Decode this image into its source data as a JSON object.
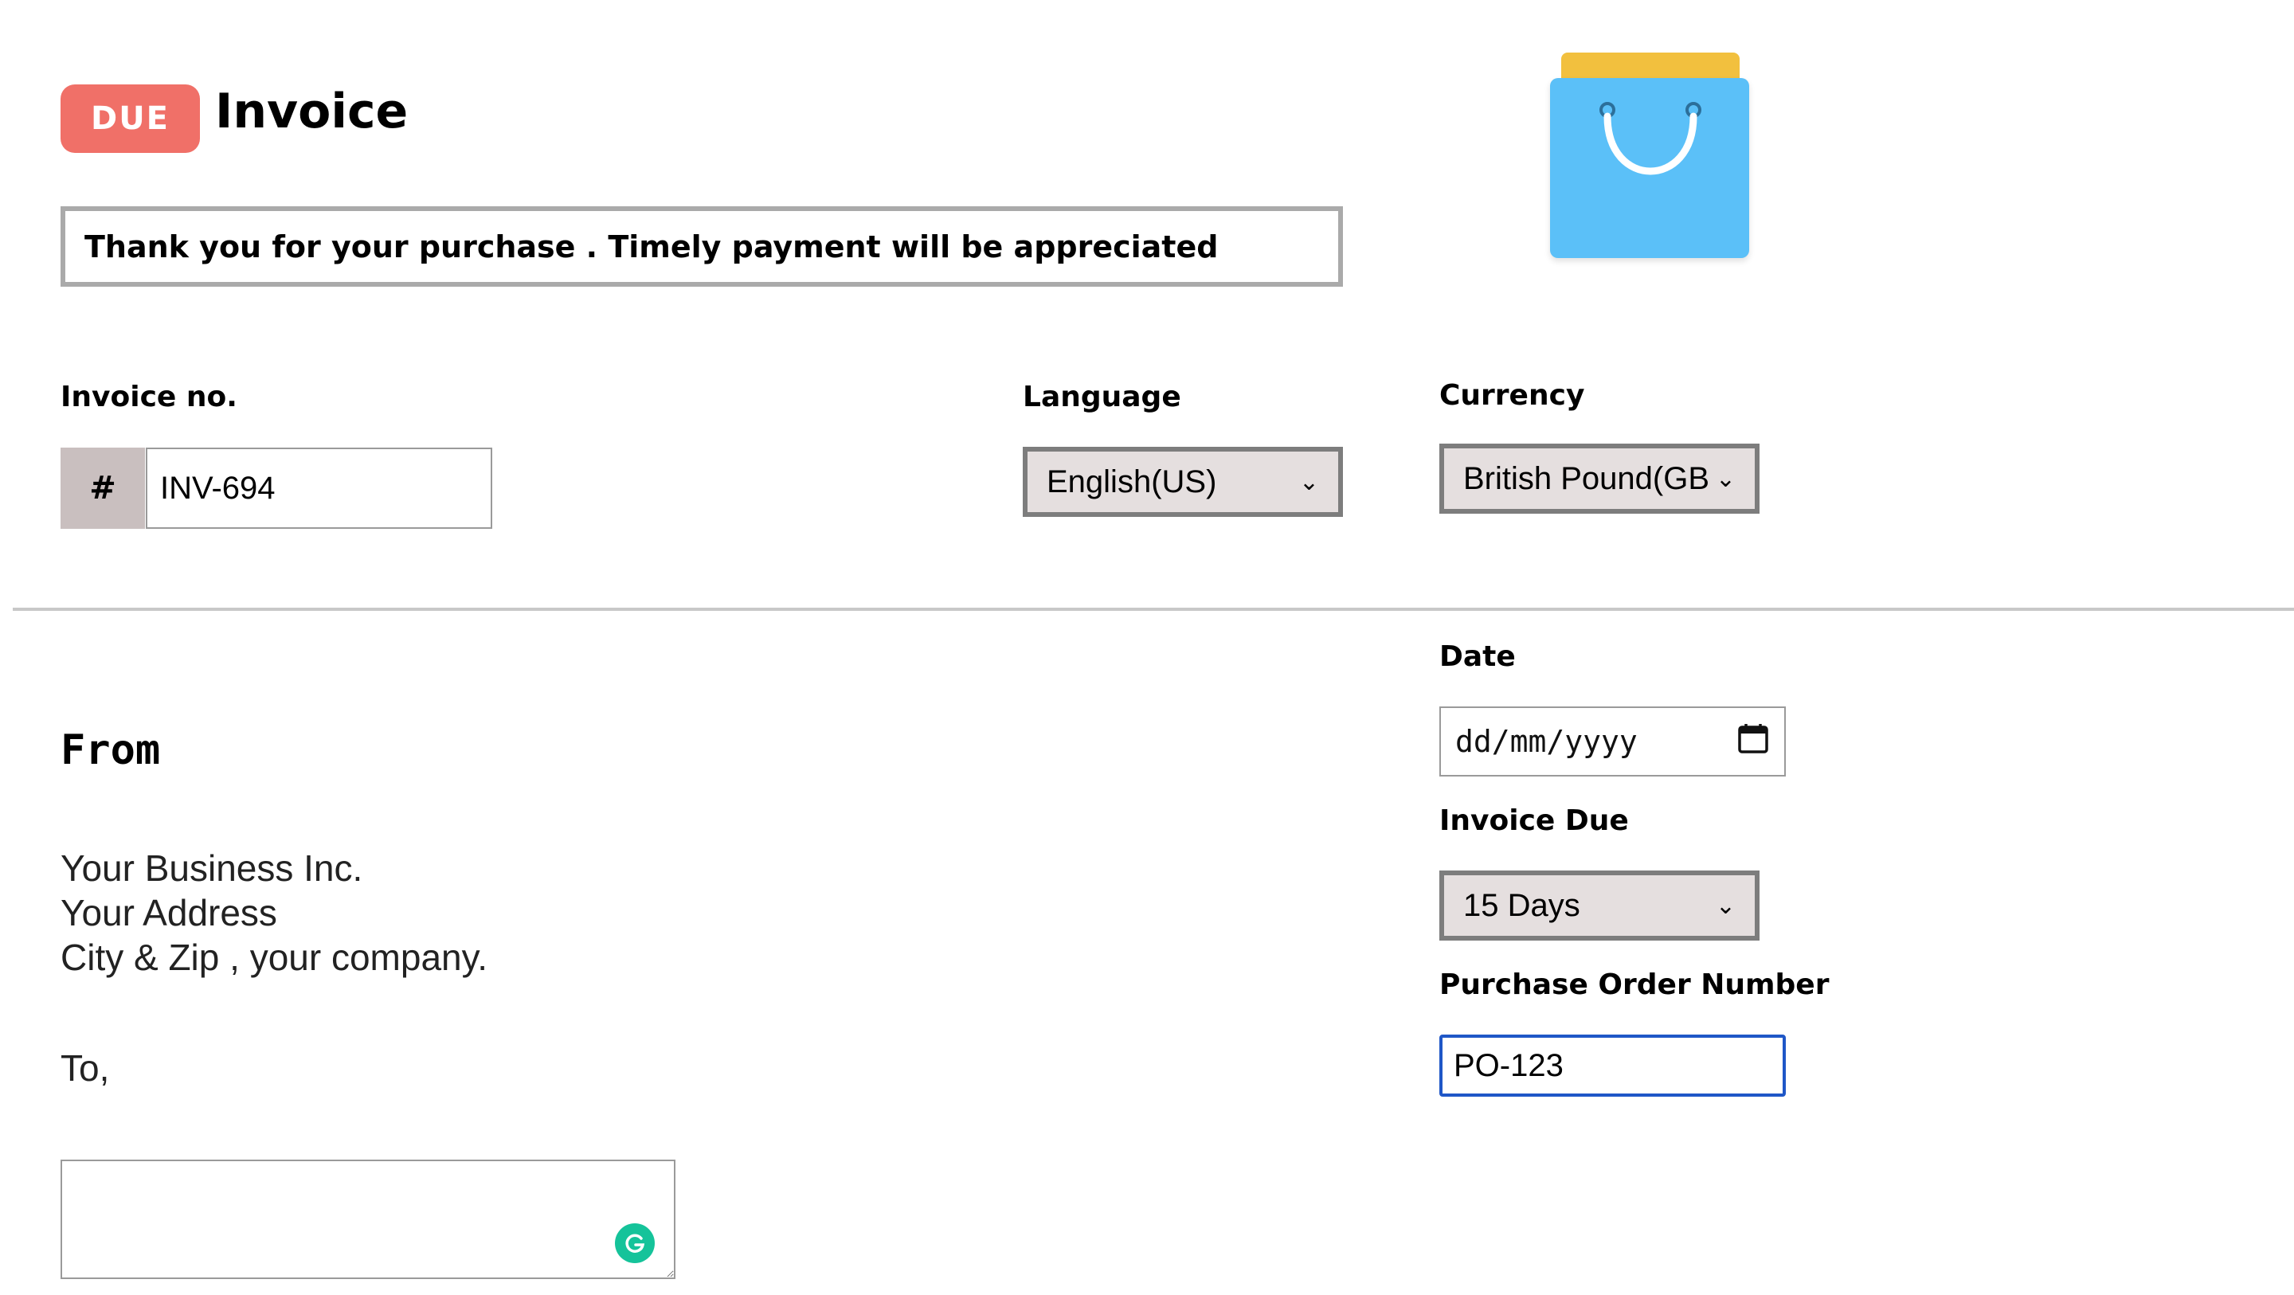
{
  "header": {
    "badge": "DUE",
    "title": "Invoice",
    "message": "Thank you for your purchase . Timely payment will be appreciated"
  },
  "invoice_no": {
    "label": "Invoice no.",
    "prefix": "#",
    "value": "INV-694"
  },
  "language": {
    "label": "Language",
    "selected": "English(US)"
  },
  "currency": {
    "label": "Currency",
    "selected": "British Pound(GBP)"
  },
  "date": {
    "label": "Date",
    "placeholder": "dd/mm/yyyy"
  },
  "invoice_due": {
    "label": "Invoice Due",
    "selected": "15 Days"
  },
  "po": {
    "label": "Purchase Order Number",
    "value": "PO-123"
  },
  "from": {
    "heading": "From",
    "lines": [
      "Your Business Inc.",
      "Your Address",
      "City & Zip , your company."
    ]
  },
  "to": {
    "label": "To,",
    "value": ""
  },
  "colors": {
    "badge": "#f07068",
    "bag_body": "#5bc0f8",
    "bag_top": "#f2c03e",
    "focus_border": "#1f57c7",
    "grammarly": "#15c39a"
  },
  "icons": {
    "bag": "shopping-bag-icon",
    "calendar": "calendar-icon",
    "grammarly": "grammarly-icon",
    "dropdown": "chevron-down-icon"
  }
}
